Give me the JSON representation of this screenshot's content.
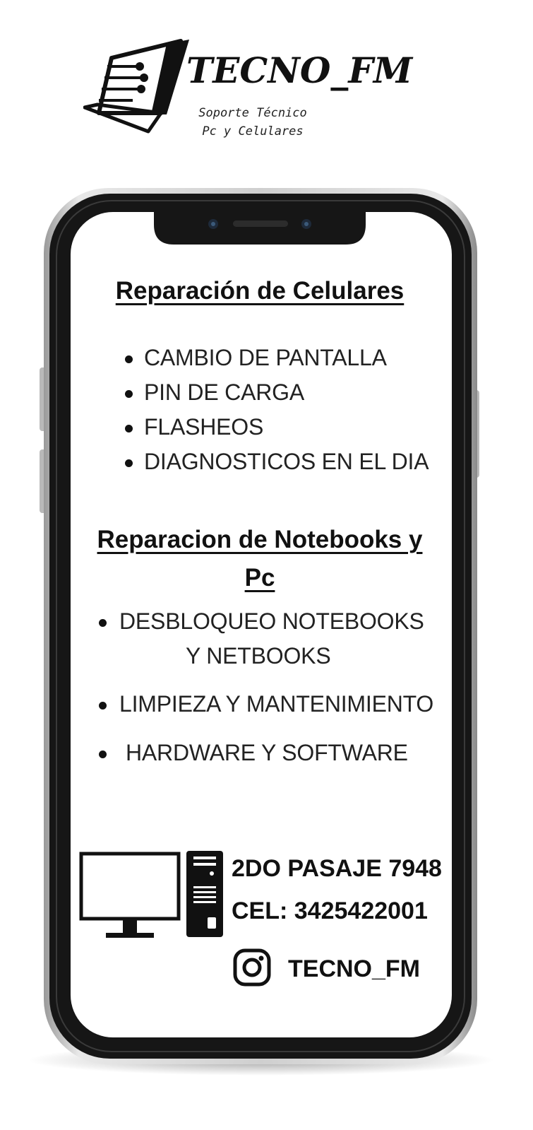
{
  "brand": {
    "name": "TECNO_FM",
    "tagline_line1": "Soporte Técnico",
    "tagline_line2": "Pc y Celulares"
  },
  "sections": [
    {
      "title": "Reparación de Celulares",
      "items": [
        "CAMBIO DE PANTALLA",
        "PIN DE CARGA",
        "FLASHEOS",
        "DIAGNOSTICOS EN EL DIA"
      ]
    },
    {
      "title_line1": "Reparacion de Notebooks y",
      "title_line2": "Pc",
      "items": [
        "DESBLOQUEO NOTEBOOKS",
        "Y NETBOOKS",
        "LIMPIEZA Y MANTENIMIENTO",
        "HARDWARE Y SOFTWARE"
      ]
    }
  ],
  "contact": {
    "address": "2DO PASAJE 7948",
    "phone": "CEL: 3425422001",
    "instagram": "TECNO_FM"
  },
  "icons": {
    "logo": "laptop-circuit-icon",
    "computer": "desktop-computer-icon",
    "social": "instagram-icon"
  },
  "colors": {
    "text": "#111111",
    "phone_frame": "#1a1a1a",
    "background": "#ffffff"
  }
}
